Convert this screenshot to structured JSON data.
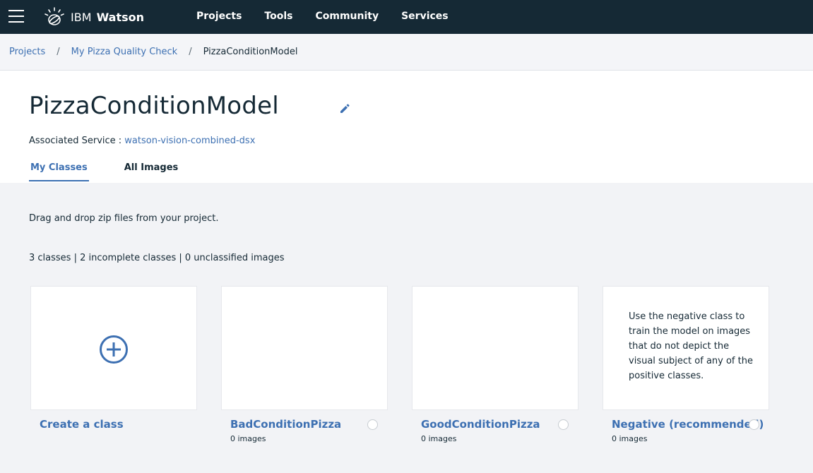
{
  "topbar": {
    "brand_light": "IBM",
    "brand_bold": "Watson",
    "nav": [
      "Projects",
      "Tools",
      "Community",
      "Services"
    ]
  },
  "breadcrumb": [
    "Projects",
    "My Pizza Quality Check",
    "PizzaConditionModel"
  ],
  "header": {
    "title": "PizzaConditionModel",
    "service_label": "Associated Service : ",
    "service_link": "watson-vision-combined-dsx",
    "tabs": [
      "My Classes",
      "All Images"
    ]
  },
  "main": {
    "hint": "Drag and drop zip files from your project.",
    "counts": "3 classes | 2 incomplete classes | 0 unclassified images"
  },
  "cards": {
    "create": "Create a class",
    "classes": [
      {
        "name": "BadConditionPizza",
        "count": "0 images"
      },
      {
        "name": "GoodConditionPizza",
        "count": "0 images"
      },
      {
        "name": "Negative (recommended)",
        "count": "0 images",
        "description": "Use the negative class to train the model on images that do not depict the visual subject of any of the positive classes."
      }
    ]
  },
  "colors": {
    "topbar": "#152935",
    "accent": "#3d70b2",
    "background": "#f2f3f6"
  },
  "icons": [
    "hamburger-icon",
    "watson-logo-icon",
    "edit-pencil-icon",
    "plus-circle-icon",
    "radio-icon"
  ]
}
